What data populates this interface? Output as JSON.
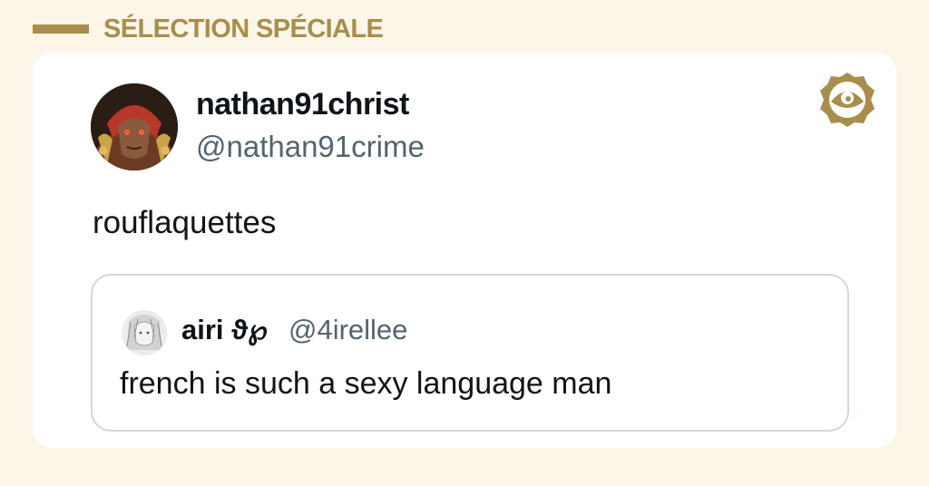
{
  "header": {
    "label": "SÉLECTION SPÉCIALE"
  },
  "colors": {
    "background": "#fcf6e9",
    "accent": "#a88e4a",
    "card": "#ffffff",
    "primary_text": "#0f1419",
    "secondary_text": "#536471",
    "quote_border": "#cfd9de"
  },
  "tweet": {
    "display_name": "nathan91christ",
    "handle": "@nathan91crime",
    "text": "rouflaquettes",
    "avatar_icon": "fantasy-character-avatar"
  },
  "brand": {
    "icon": "eye-badge-logo"
  },
  "quoted_tweet": {
    "display_name": "airi ϑ℘",
    "handle": "@4irellee",
    "text": "french is such a sexy language man",
    "avatar_icon": "sketch-portrait-avatar"
  }
}
